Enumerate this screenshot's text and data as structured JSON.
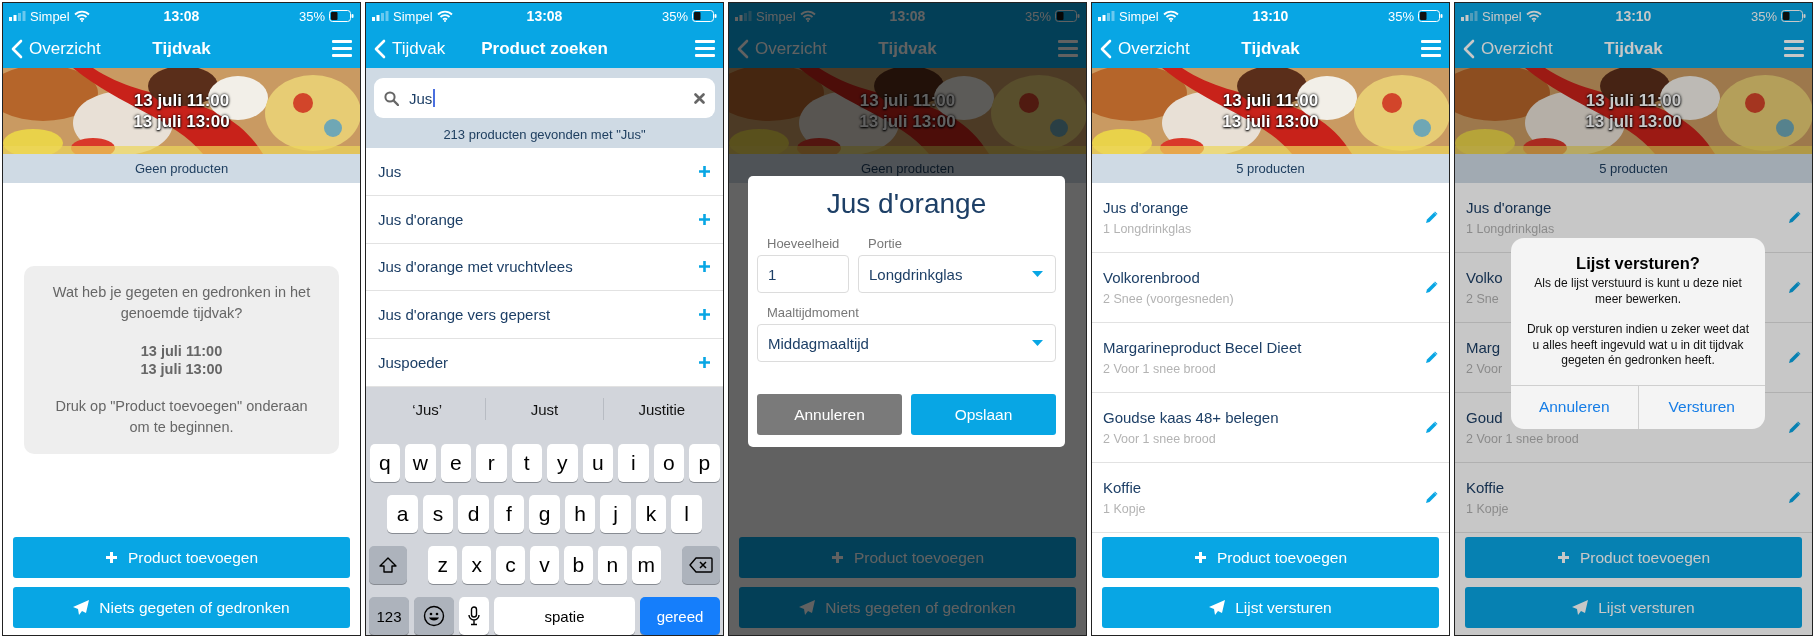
{
  "screens": [
    {
      "kind": "period",
      "status_bar": {
        "carrier": "Simpel",
        "time": "13:08",
        "battery": "35%"
      },
      "nav": {
        "back": "Overzicht",
        "title": "Tijdvak"
      },
      "banner": {
        "lines": [
          "13 juli 11:00",
          "13 juli 13:00"
        ]
      },
      "count": "Geen producten",
      "empty_card": {
        "question": "Wat heb je gegeten en gedronken in het genoemde tijdvak?",
        "dates": [
          "13 juli 11:00",
          "13 juli 13:00"
        ],
        "hint": "Druk op \"Product toevoegen\" onderaan om te beginnen."
      },
      "buttons": [
        {
          "kind": "add",
          "label": "Product toevoegen"
        },
        {
          "kind": "send",
          "label": "Niets gegeten of gedronken"
        }
      ]
    },
    {
      "kind": "search",
      "status_bar": {
        "carrier": "Simpel",
        "time": "13:08",
        "battery": "35%"
      },
      "nav": {
        "back": "Tijdvak",
        "title": "Product zoeken"
      },
      "search": {
        "value": "Jus"
      },
      "result_count": "213 producten gevonden met \"Jus\"",
      "results": [
        "Jus",
        "Jus d'orange",
        "Jus d'orange met vruchtvlees",
        "Jus d'orange vers geperst",
        "Juspoeder"
      ],
      "keyboard": {
        "suggestions": [
          "‘Jus’",
          "Just",
          "Justitie"
        ],
        "rows": [
          [
            "q",
            "w",
            "e",
            "r",
            "t",
            "y",
            "u",
            "i",
            "o",
            "p"
          ],
          [
            "a",
            "s",
            "d",
            "f",
            "g",
            "h",
            "j",
            "k",
            "l"
          ],
          [
            "z",
            "x",
            "c",
            "v",
            "b",
            "n",
            "m"
          ]
        ],
        "numbers": "123",
        "space": "spatie",
        "done": "gereed"
      }
    },
    {
      "kind": "period",
      "status_bar": {
        "carrier": "Simpel",
        "time": "13:08",
        "battery": "35%"
      },
      "nav": {
        "back": "Overzicht",
        "title": "Tijdvak"
      },
      "banner": {
        "lines": [
          "13 juli 11:00",
          "13 juli 13:00"
        ]
      },
      "count": "Geen producten",
      "buttons": [
        {
          "kind": "add",
          "label": "Product toevoegen"
        },
        {
          "kind": "send",
          "label": "Niets gegeten of gedronken"
        }
      ],
      "modal": {
        "title": "Jus d'orange",
        "fields": [
          {
            "kind": "text",
            "label": "Hoeveelheid",
            "value": "1"
          },
          {
            "kind": "select",
            "label": "Portie",
            "value": "Longdrinkglas"
          },
          {
            "kind": "select",
            "label": "Maaltijdmoment",
            "value": "Middagmaaltijd"
          }
        ],
        "buttons": [
          {
            "kind": "cancel",
            "label": "Annuleren"
          },
          {
            "kind": "primary",
            "label": "Opslaan"
          }
        ]
      }
    },
    {
      "kind": "period",
      "status_bar": {
        "carrier": "Simpel",
        "time": "13:10",
        "battery": "35%"
      },
      "nav": {
        "back": "Overzicht",
        "title": "Tijdvak"
      },
      "banner": {
        "lines": [
          "13 juli 11:00",
          "13 juli 13:00"
        ]
      },
      "count": "5 producten",
      "products": [
        {
          "name": "Jus d'orange",
          "portion": "1 Longdrinkglas"
        },
        {
          "name": "Volkorenbrood",
          "portion": "2 Snee (voorgesneden)"
        },
        {
          "name": "Margarineproduct Becel Dieet",
          "portion": "2 Voor 1 snee brood"
        },
        {
          "name": "Goudse kaas 48+ belegen",
          "portion": "2 Voor 1 snee brood"
        },
        {
          "name": "Koffie",
          "portion": "1 Kopje"
        }
      ],
      "buttons": [
        {
          "kind": "add",
          "label": "Product toevoegen"
        },
        {
          "kind": "send",
          "label": "Lijst versturen"
        }
      ]
    },
    {
      "kind": "period",
      "status_bar": {
        "carrier": "Simpel",
        "time": "13:10",
        "battery": "35%"
      },
      "nav": {
        "back": "Overzicht",
        "title": "Tijdvak"
      },
      "banner": {
        "lines": [
          "13 juli 11:00",
          "13 juli 13:00"
        ]
      },
      "count": "5 producten",
      "products": [
        {
          "name": "Jus d'orange",
          "portion": "1 Longdrinkglas"
        },
        {
          "name": "Volko",
          "portion": "2 Sne"
        },
        {
          "name": "Marg",
          "portion": "2 Voor"
        },
        {
          "name": "Goud",
          "portion": "2 Voor 1 snee brood"
        },
        {
          "name": "Koffie",
          "portion": "1 Kopje"
        }
      ],
      "buttons": [
        {
          "kind": "add",
          "label": "Product toevoegen"
        },
        {
          "kind": "send",
          "label": "Lijst versturen"
        }
      ],
      "alert": {
        "title": "Lijst versturen?",
        "paragraphs": [
          "Als de lijst verstuurd is kunt u deze niet meer bewerken.",
          "Druk op versturen indien u zeker weet dat u alles heeft ingevuld wat u in dit tijdvak gegeten én gedronken heeft."
        ],
        "buttons": [
          "Annuleren",
          "Versturen"
        ]
      }
    }
  ]
}
